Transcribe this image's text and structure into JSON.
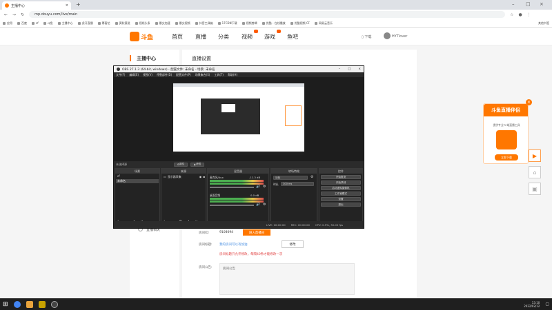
{
  "browser": {
    "tab_title": "主播中心",
    "url": "mp.douyu.com/live/main",
    "bookmarks": [
      "应用",
      "百度",
      "cf",
      "斗鱼",
      "主播中心",
      "虎牙直播",
      "慕客艺",
      "黄秋薇说",
      "视线头条",
      "暴尖加速",
      "暴尖视频",
      "抖音工具箱",
      "17CDN下载",
      "视频剪辑",
      "优酷 - 在线播放",
      "优酷视频 CF",
      "网易云音乐"
    ],
    "other_bookmarks": "其他书签"
  },
  "site": {
    "logo_text": "斗鱼",
    "nav": [
      "首页",
      "直播",
      "分类",
      "视频",
      "游戏",
      "鱼吧"
    ],
    "download": "下载",
    "username": "HYTlover"
  },
  "sidebar": {
    "heading": "主播中心",
    "item_bottom": "直播相关"
  },
  "main": {
    "title": "直播设置",
    "room_label": "房间ID:",
    "room_id": "9108094",
    "enter_button": "进入直播间",
    "title_label": "房间标题:",
    "title_value": "我的房间可以有加油",
    "title_hint": "房间标题只允许修改，每隔40秒才能修改一次",
    "edit_button": "修改",
    "notice_label": "房间公告:",
    "notice_text": "房间公告"
  },
  "obs": {
    "window_title": "OBS 27.1.3 (64-bit, windows) - 配置文件: 未命名 - 场景: 未命名",
    "menu": [
      "文件(F)",
      "编辑(E)",
      "视图(V)",
      "停靠部件(D)",
      "配置文件(P)",
      "场景集合(S)",
      "工具(T)",
      "帮助(H)"
    ],
    "no_source": "未选择源",
    "props_btn": "属性",
    "filter_btn": "滤镜",
    "docks": {
      "scenes": {
        "title": "场景",
        "items": [
          "cf",
          "未命名"
        ]
      },
      "sources": {
        "title": "来源",
        "items": [
          "显示器采集"
        ]
      },
      "mixer": {
        "title": "混音器",
        "ch1": "桌面音频",
        "ch1_db": "-11.3 dB",
        "ch2": "麦克风/Aux",
        "ch2_db": "0.0 dB"
      },
      "transitions": {
        "title": "转场特效",
        "type": "淡化",
        "duration_label": "时长",
        "duration": "300 ms"
      },
      "controls": {
        "title": "控件",
        "buttons": [
          "开始推流",
          "开始录制",
          "启动虚拟摄像机",
          "工作室模式",
          "设置",
          "退出"
        ]
      }
    },
    "status": {
      "live": "LIVE: 00:00:00",
      "rec": "REC: 00:00:00",
      "cpu": "CPU: 0.9%, 30.00 fps"
    }
  },
  "ad": {
    "title": "斗鱼直播伴侣",
    "subtitle": "提供专业PC端直播工具",
    "button": "立即下载"
  },
  "taskbar": {
    "time": "13:10",
    "date": "2022/02/12"
  },
  "colors": {
    "brand": "#ff7700",
    "obs_bg": "#2b2b2b",
    "meter_green": "#4caf50"
  }
}
